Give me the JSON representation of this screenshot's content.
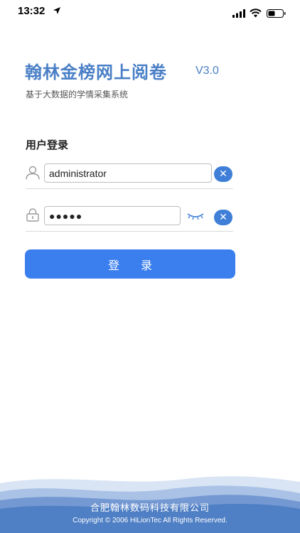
{
  "status_bar": {
    "time": "13:32"
  },
  "header": {
    "title": "翰林金榜网上阅卷",
    "version": "V3.0",
    "subtitle": "基于大数据的学情采集系统"
  },
  "login": {
    "heading": "用户登录",
    "username_value": "administrator",
    "password_masked": "●●●●●",
    "clear_symbol": "✕",
    "button_label": "登录"
  },
  "footer": {
    "company": "合肥翰林数码科技有限公司",
    "copyright": "Copyright © 2006  HiLionTec All Rights Reserved."
  },
  "colors": {
    "brand_blue": "#4a7fc6",
    "button_blue": "#3b7fef",
    "clear_blue": "#3f7fd8"
  }
}
